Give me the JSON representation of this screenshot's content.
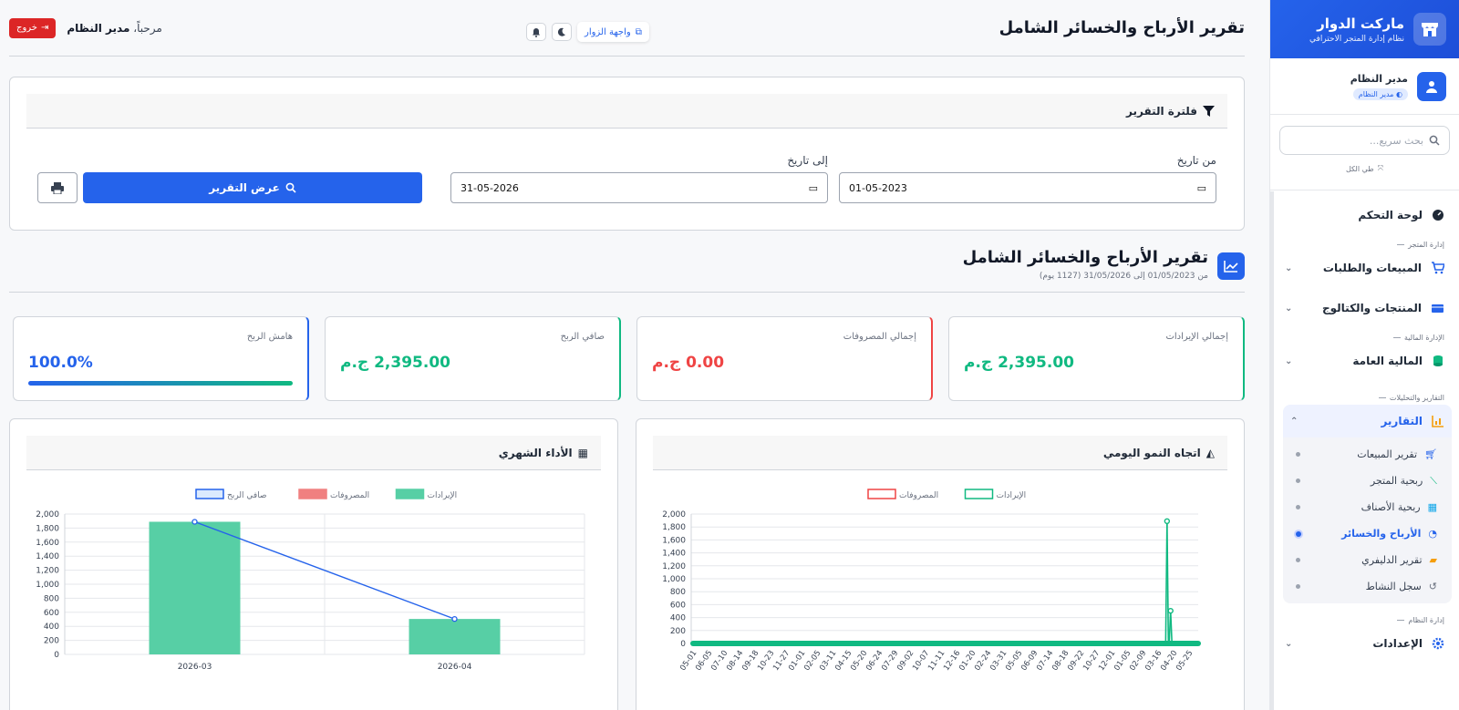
{
  "sidebar": {
    "brand_title": "ماركت الدوار",
    "brand_subtitle": "نظام إدارة المتجر الاحترافي",
    "user_name": "مدير النظام",
    "user_role": "مدير النظام",
    "search_placeholder": "بحث سريع...",
    "collapse_all": "طي الكل",
    "dashboard": "لوحة التحكم",
    "sec_store": "إدارة المتجر",
    "sales_orders": "المبيعات والطلبات",
    "products_catalog": "المنتجات والكتالوج",
    "sec_finance": "الإدارة المالية",
    "general_finance": "المالية العامة",
    "sec_reports": "التقارير والتحليلات",
    "reports": "التقارير",
    "sub_items": [
      "تقرير المبيعات",
      "ربحية المتجر",
      "ربحية الأصناف",
      "الأرباح والخسائر",
      "تقرير الدليفري",
      "سجل النشاط"
    ],
    "sec_system": "إدارة النظام",
    "settings": "الإعدادات"
  },
  "header": {
    "title": "تقرير الأرباح والخسائر الشامل",
    "visitor_link": "واجهة الزوار",
    "welcome_prefix": "مرحباً،",
    "welcome_name": "مدير النظام",
    "logout": "خروج"
  },
  "filter": {
    "title": "فلترة التقرير",
    "from_label": "من تاريخ",
    "from_value": "01-05-2023",
    "to_label": "إلى تاريخ",
    "to_value": "31-05-2026",
    "show_button": "عرض التقرير"
  },
  "report": {
    "title": "تقرير الأرباح والخسائر الشامل",
    "range": "من 01/05/2023 إلى 31/05/2026 (1127 يوم)"
  },
  "stats": {
    "revenue_label": "إجمالي الإيرادات",
    "revenue_value": "2,395.00 ج.م",
    "expenses_label": "إجمالي المصروفات",
    "expenses_value": "0.00 ج.م",
    "net_label": "صافي الربح",
    "net_value": "2,395.00 ج.م",
    "margin_label": "هامش الربح",
    "margin_value": "100.0%",
    "margin_fraction": 1.0
  },
  "colors": {
    "green": "#10b981",
    "red": "#ef4444",
    "blue": "#2563eb",
    "revenue_fill": "#57cfa5",
    "expense_fill": "#f08080"
  },
  "chart_data": [
    {
      "type": "line",
      "title": "اتجاه النمو اليومي",
      "legend": [
        "المصروفات",
        "الإيرادات"
      ],
      "ylim": [
        0,
        2000
      ],
      "y_ticks": [
        "2,000",
        "1,800",
        "1,600",
        "1,400",
        "1,200",
        "1,000",
        "800",
        "600",
        "400",
        "200",
        "0"
      ],
      "x_ticks": [
        "05-01",
        "06-05",
        "07-10",
        "08-14",
        "09-18",
        "10-23",
        "11-27",
        "01-01",
        "02-05",
        "03-11",
        "04-15",
        "05-20",
        "06-24",
        "07-29",
        "09-02",
        "10-07",
        "11-11",
        "12-16",
        "01-20",
        "02-24",
        "03-31",
        "05-05",
        "06-09",
        "07-14",
        "08-18",
        "09-22",
        "10-27",
        "12-01",
        "01-05",
        "02-09",
        "03-16",
        "04-20",
        "05-25"
      ],
      "series": [
        {
          "name": "الإيرادات",
          "points": [
            {
              "x": "2026-03-28",
              "y": 1890
            },
            {
              "x": "2026-04-05",
              "y": 505
            }
          ]
        },
        {
          "name": "المصروفات",
          "points": []
        }
      ]
    },
    {
      "type": "bar",
      "title": "الأداء الشهري",
      "legend": [
        "صافي الربح",
        "المصروفات",
        "الإيرادات"
      ],
      "categories": [
        "2026-03",
        "2026-04"
      ],
      "ylim": [
        0,
        2000
      ],
      "y_ticks": [
        "2,000",
        "1,800",
        "1,600",
        "1,400",
        "1,200",
        "1,000",
        "800",
        "600",
        "400",
        "200",
        "0"
      ],
      "series": [
        {
          "name": "الإيرادات",
          "values": [
            1890,
            505
          ]
        },
        {
          "name": "المصروفات",
          "values": [
            0,
            0
          ]
        },
        {
          "name": "صافي الربح",
          "values": [
            1890,
            505
          ]
        }
      ]
    }
  ]
}
